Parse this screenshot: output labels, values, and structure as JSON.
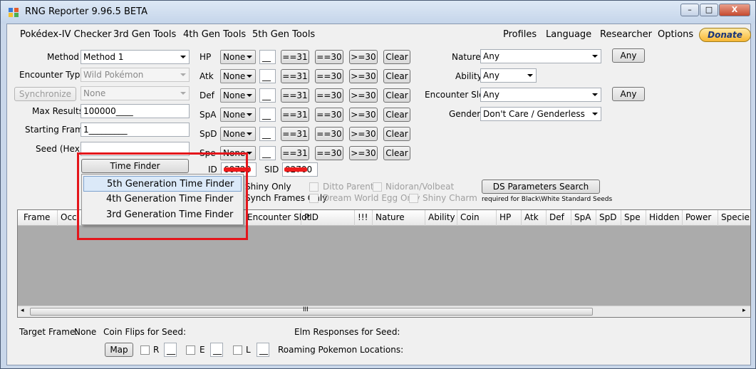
{
  "window": {
    "title": "RNG Reporter 9.96.5 BETA",
    "minimize": "–",
    "maximize": "□",
    "close": "X"
  },
  "menu": {
    "left": [
      "Pokédex-IV Checker",
      "3rd Gen Tools",
      "4th Gen Tools",
      "5th Gen Tools"
    ],
    "right": [
      "Profiles",
      "Language",
      "Researcher",
      "Options"
    ],
    "donate": "Donate"
  },
  "left_form": {
    "method_label": "Method",
    "method_value": "Method 1",
    "encounter_type_label": "Encounter Type",
    "encounter_type_value": "Wild Pokémon",
    "synchronize_button": "Synchronize",
    "synchronize_value": "None",
    "max_results_label": "Max Results",
    "max_results_value": "100000____",
    "starting_frame_label": "Starting Frame",
    "starting_frame_value": "1_________",
    "seed_label": "Seed (Hex)",
    "seed_value": "",
    "time_finder_button": "Time Finder"
  },
  "ivs": {
    "rows": [
      {
        "stat": "HP",
        "compare": "None",
        "value": "__"
      },
      {
        "stat": "Atk",
        "compare": "None",
        "value": "__"
      },
      {
        "stat": "Def",
        "compare": "None",
        "value": "__"
      },
      {
        "stat": "SpA",
        "compare": "None",
        "value": "__"
      },
      {
        "stat": "SpD",
        "compare": "None",
        "value": "__"
      },
      {
        "stat": "Spe",
        "compare": "None",
        "value": "__"
      }
    ],
    "btn_eq31": "==31",
    "btn_eq30": "==30",
    "btn_ge30": ">=30",
    "btn_clear": "Clear"
  },
  "ids": {
    "id_label": "ID",
    "id_value": "60720",
    "sid_label": "SID",
    "sid_value": "02700"
  },
  "right_form": {
    "nature_label": "Nature",
    "nature_value": "Any",
    "nature_any_button": "Any",
    "ability_label": "Ability",
    "ability_value": "Any",
    "encounter_slot_label": "Encounter Slot",
    "encounter_slot_value": "Any",
    "encounter_slot_any_button": "Any",
    "gender_label": "Gender",
    "gender_value": "Don't Care / Genderless"
  },
  "options": {
    "shiny_only": "Shiny Only",
    "synch_frames_only": "Synch Frames Only",
    "ditto_parent": "Ditto Parent",
    "nidoran_volbeat": "Nidoran/Volbeat",
    "dream_world_egg_only": "Dream World Egg Only",
    "shiny_charm": "Shiny Charm",
    "ds_params_button": "DS Parameters Search",
    "ds_params_note": "required for Black\\White Standard Seeds"
  },
  "dropdown": {
    "items": [
      "5th Generation Time Finder",
      "4th Generation Time Finder",
      "3rd Generation Time Finder"
    ],
    "selected_index": 0
  },
  "grid": {
    "columns": [
      "Frame",
      "Occ",
      "Encounter Slot",
      "PID",
      "!!!",
      "Nature",
      "Ability",
      "Coin",
      "HP",
      "Atk",
      "Def",
      "SpA",
      "SpD",
      "Spe",
      "Hidden",
      "Power",
      "Specie"
    ],
    "scroll_grip": "III"
  },
  "bottom": {
    "target_frame_label": "Target Frame:",
    "target_frame_value": "None",
    "coin_flips_label": "Coin Flips for Seed:",
    "elm_label": "Elm Responses for Seed:",
    "map_button": "Map",
    "r_label": "R",
    "e_label": "E",
    "l_label": "L",
    "blank": "__",
    "roaming_label": "Roaming Pokemon Locations:"
  },
  "colors": {
    "highlight": "#e4151b",
    "accent": "#f7b733"
  }
}
